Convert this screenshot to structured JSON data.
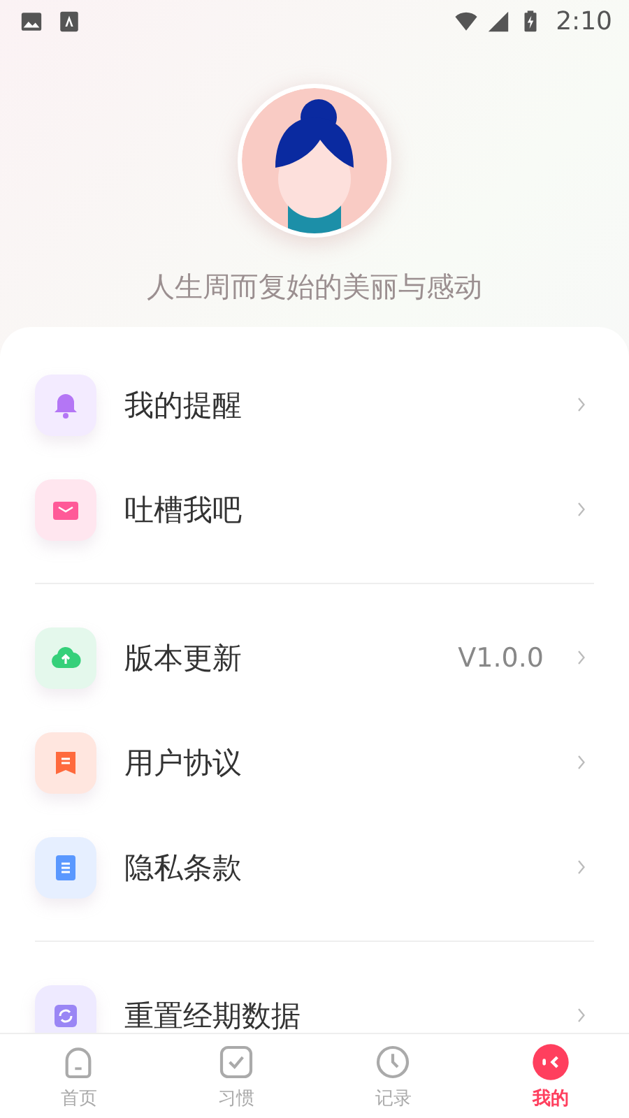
{
  "status_bar": {
    "time": "2:10"
  },
  "header": {
    "motto": "人生周而复始的美丽与感动"
  },
  "sections": [
    {
      "items": [
        {
          "kind": "bell",
          "label": "我的提醒"
        },
        {
          "kind": "mail",
          "label": "吐槽我吧"
        }
      ]
    },
    {
      "items": [
        {
          "kind": "upload",
          "label": "版本更新",
          "value": "V1.0.0"
        },
        {
          "kind": "agreement",
          "label": "用户协议"
        },
        {
          "kind": "document",
          "label": "隐私条款"
        }
      ]
    },
    {
      "items": [
        {
          "kind": "reset",
          "label": "重置经期数据"
        }
      ]
    }
  ],
  "tabs": [
    {
      "kind": "home",
      "label": "首页",
      "selected": false
    },
    {
      "kind": "habit",
      "label": "习惯",
      "selected": false
    },
    {
      "kind": "record",
      "label": "记录",
      "selected": false
    },
    {
      "kind": "me",
      "label": "我的",
      "selected": true
    }
  ]
}
